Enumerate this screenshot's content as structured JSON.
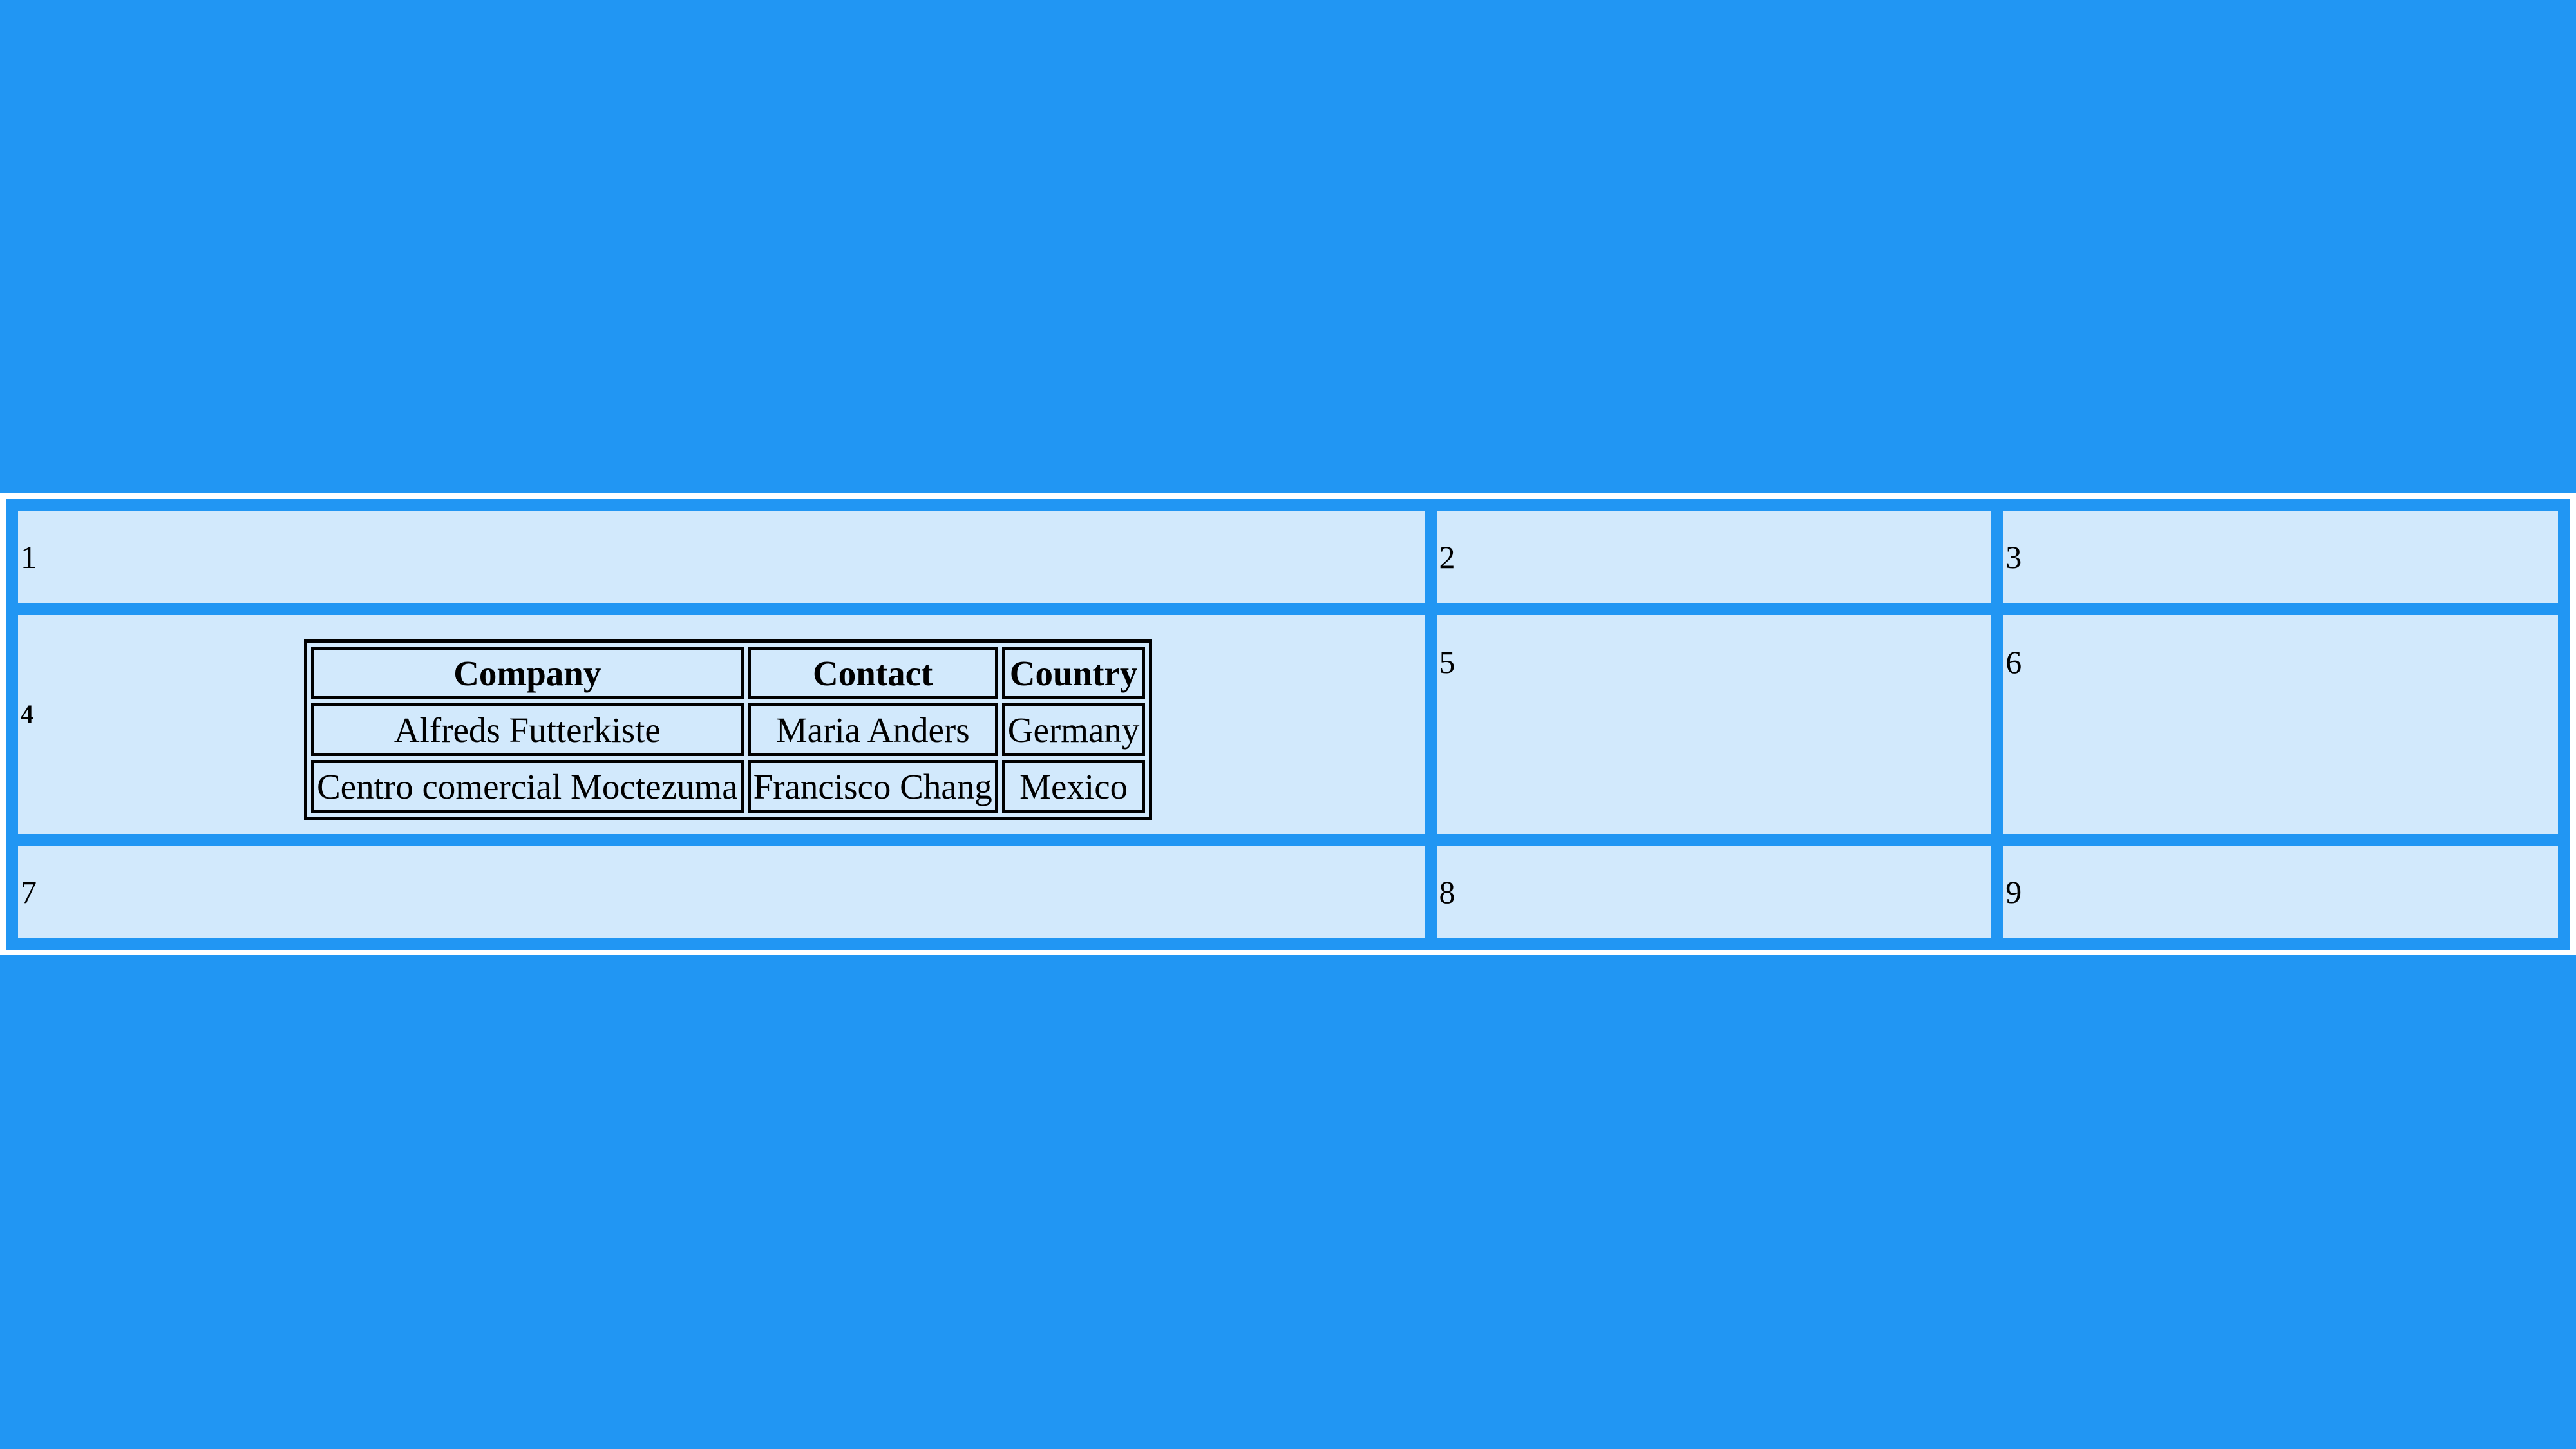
{
  "grid": {
    "cells": [
      "1",
      "2",
      "3",
      "4",
      "5",
      "6",
      "7",
      "8",
      "9"
    ]
  },
  "inner_table": {
    "headers": [
      "Company",
      "Contact",
      "Country"
    ],
    "rows": [
      [
        "Alfreds Futterkiste",
        "Maria Anders",
        "Germany"
      ],
      [
        "Centro comercial Moctezuma",
        "Francisco Chang",
        "Mexico"
      ]
    ]
  },
  "colors": {
    "background": "#2196f3",
    "cell": "#d2e9fc",
    "frame": "#ffffff",
    "border": "#000000"
  }
}
